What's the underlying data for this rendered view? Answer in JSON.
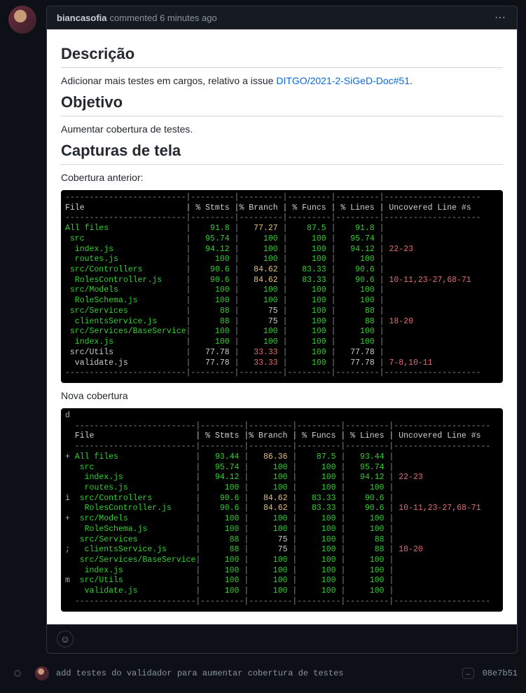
{
  "comment": {
    "author": "biancasofia",
    "action": "commented",
    "time": "6 minutes ago"
  },
  "body": {
    "h1": "Descrição",
    "p1_pre": "Adicionar mais testes em cargos, relativo a issue ",
    "p1_link": "DITGO/2021-2-SiGeD-Doc#51",
    "p1_post": ".",
    "h2": "Objetivo",
    "p2": "Aumentar cobertura de testes.",
    "h3": "Capturas de tela",
    "cov_before_label": "Cobertura anterior:",
    "cov_after_label": "Nova cobertura"
  },
  "coverage_headers": [
    "File",
    "% Stmts",
    "% Branch",
    "% Funcs",
    "% Lines",
    "Uncovered Line #s"
  ],
  "coverage_before": [
    {
      "f": "All files",
      "c": "g",
      "s": "91.8",
      "sc": "g",
      "b": "77.27",
      "bc": "y",
      "fu": "87.5",
      "fc": "g",
      "l": "91.8",
      "lc": "g",
      "u": "",
      "uc": ""
    },
    {
      "f": " src",
      "c": "g",
      "s": "95.74",
      "sc": "g",
      "b": "100",
      "bc": "g",
      "fu": "100",
      "fc": "g",
      "l": "95.74",
      "lc": "g",
      "u": "",
      "uc": ""
    },
    {
      "f": "  index.js",
      "c": "g",
      "s": "94.12",
      "sc": "g",
      "b": "100",
      "bc": "g",
      "fu": "100",
      "fc": "g",
      "l": "94.12",
      "lc": "g",
      "u": "22-23",
      "uc": "r"
    },
    {
      "f": "  routes.js",
      "c": "g",
      "s": "100",
      "sc": "g",
      "b": "100",
      "bc": "g",
      "fu": "100",
      "fc": "g",
      "l": "100",
      "lc": "g",
      "u": "",
      "uc": ""
    },
    {
      "f": " src/Controllers",
      "c": "g",
      "s": "90.6",
      "sc": "g",
      "b": "84.62",
      "bc": "y",
      "fu": "83.33",
      "fc": "g",
      "l": "90.6",
      "lc": "g",
      "u": "",
      "uc": ""
    },
    {
      "f": "  RolesController.js",
      "c": "g",
      "s": "90.6",
      "sc": "g",
      "b": "84.62",
      "bc": "y",
      "fu": "83.33",
      "fc": "g",
      "l": "90.6",
      "lc": "g",
      "u": "10-11,23-27,68-71",
      "uc": "r"
    },
    {
      "f": " src/Models",
      "c": "g",
      "s": "100",
      "sc": "g",
      "b": "100",
      "bc": "g",
      "fu": "100",
      "fc": "g",
      "l": "100",
      "lc": "g",
      "u": "",
      "uc": ""
    },
    {
      "f": "  RoleSchema.js",
      "c": "g",
      "s": "100",
      "sc": "g",
      "b": "100",
      "bc": "g",
      "fu": "100",
      "fc": "g",
      "l": "100",
      "lc": "g",
      "u": "",
      "uc": ""
    },
    {
      "f": " src/Services",
      "c": "g",
      "s": "88",
      "sc": "g",
      "b": "75",
      "bc": "w",
      "fu": "100",
      "fc": "g",
      "l": "88",
      "lc": "g",
      "u": "",
      "uc": ""
    },
    {
      "f": "  clientsService.js",
      "c": "g",
      "s": "88",
      "sc": "g",
      "b": "75",
      "bc": "w",
      "fu": "100",
      "fc": "g",
      "l": "88",
      "lc": "g",
      "u": "18-20",
      "uc": "r"
    },
    {
      "f": " src/Services/BaseService",
      "c": "g",
      "s": "100",
      "sc": "g",
      "b": "100",
      "bc": "g",
      "fu": "100",
      "fc": "g",
      "l": "100",
      "lc": "g",
      "u": "",
      "uc": ""
    },
    {
      "f": "  index.js",
      "c": "g",
      "s": "100",
      "sc": "g",
      "b": "100",
      "bc": "g",
      "fu": "100",
      "fc": "g",
      "l": "100",
      "lc": "g",
      "u": "",
      "uc": ""
    },
    {
      "f": " src/Utils",
      "c": "w",
      "s": "77.78",
      "sc": "w",
      "b": "33.33",
      "bc": "r",
      "fu": "100",
      "fc": "g",
      "l": "77.78",
      "lc": "w",
      "u": "",
      "uc": ""
    },
    {
      "f": "  validate.js",
      "c": "w",
      "s": "77.78",
      "sc": "w",
      "b": "33.33",
      "bc": "r",
      "fu": "100",
      "fc": "g",
      "l": "77.78",
      "lc": "w",
      "u": "7-8,10-11",
      "uc": "r"
    }
  ],
  "coverage_after": [
    {
      "f": "All files",
      "c": "g",
      "s": "93.44",
      "sc": "g",
      "b": "86.36",
      "bc": "y",
      "fu": "87.5",
      "fc": "g",
      "l": "93.44",
      "lc": "g",
      "u": "",
      "uc": "",
      "mk": "+"
    },
    {
      "f": " src",
      "c": "g",
      "s": "95.74",
      "sc": "g",
      "b": "100",
      "bc": "g",
      "fu": "100",
      "fc": "g",
      "l": "95.74",
      "lc": "g",
      "u": "",
      "uc": ""
    },
    {
      "f": "  index.js",
      "c": "g",
      "s": "94.12",
      "sc": "g",
      "b": "100",
      "bc": "g",
      "fu": "100",
      "fc": "g",
      "l": "94.12",
      "lc": "g",
      "u": "22-23",
      "uc": "r"
    },
    {
      "f": "  routes.js",
      "c": "g",
      "s": "100",
      "sc": "g",
      "b": "100",
      "bc": "g",
      "fu": "100",
      "fc": "g",
      "l": "100",
      "lc": "g",
      "u": "",
      "uc": ""
    },
    {
      "f": " src/Controllers",
      "c": "g",
      "s": "90.6",
      "sc": "g",
      "b": "84.62",
      "bc": "y",
      "fu": "83.33",
      "fc": "g",
      "l": "90.6",
      "lc": "g",
      "u": "",
      "uc": "",
      "mk": "i"
    },
    {
      "f": "  RolesController.js",
      "c": "g",
      "s": "90.6",
      "sc": "g",
      "b": "84.62",
      "bc": "y",
      "fu": "83.33",
      "fc": "g",
      "l": "90.6",
      "lc": "g",
      "u": "10-11,23-27,68-71",
      "uc": "r"
    },
    {
      "f": " src/Models",
      "c": "g",
      "s": "100",
      "sc": "g",
      "b": "100",
      "bc": "g",
      "fu": "100",
      "fc": "g",
      "l": "100",
      "lc": "g",
      "u": "",
      "uc": "",
      "mk": "+"
    },
    {
      "f": "  RoleSchema.js",
      "c": "g",
      "s": "100",
      "sc": "g",
      "b": "100",
      "bc": "g",
      "fu": "100",
      "fc": "g",
      "l": "100",
      "lc": "g",
      "u": "",
      "uc": ""
    },
    {
      "f": " src/Services",
      "c": "g",
      "s": "88",
      "sc": "g",
      "b": "75",
      "bc": "w",
      "fu": "100",
      "fc": "g",
      "l": "88",
      "lc": "g",
      "u": "",
      "uc": ""
    },
    {
      "f": "  clientsService.js",
      "c": "g",
      "s": "88",
      "sc": "g",
      "b": "75",
      "bc": "w",
      "fu": "100",
      "fc": "g",
      "l": "88",
      "lc": "g",
      "u": "18-20",
      "uc": "r",
      "mk": ";"
    },
    {
      "f": " src/Services/BaseService",
      "c": "g",
      "s": "100",
      "sc": "g",
      "b": "100",
      "bc": "g",
      "fu": "100",
      "fc": "g",
      "l": "100",
      "lc": "g",
      "u": "",
      "uc": ""
    },
    {
      "f": "  index.js",
      "c": "g",
      "s": "100",
      "sc": "g",
      "b": "100",
      "bc": "g",
      "fu": "100",
      "fc": "g",
      "l": "100",
      "lc": "g",
      "u": "",
      "uc": ""
    },
    {
      "f": " src/Utils",
      "c": "g",
      "s": "100",
      "sc": "g",
      "b": "100",
      "bc": "g",
      "fu": "100",
      "fc": "g",
      "l": "100",
      "lc": "g",
      "u": "",
      "uc": "",
      "mk": "m"
    },
    {
      "f": "  validate.js",
      "c": "g",
      "s": "100",
      "sc": "g",
      "b": "100",
      "bc": "g",
      "fu": "100",
      "fc": "g",
      "l": "100",
      "lc": "g",
      "u": "",
      "uc": ""
    }
  ],
  "colW": {
    "mk": 2,
    "file": 25,
    "num": 9,
    "unc": 20
  },
  "commit": {
    "message": "add testes do validador para aumentar cobertura de testes",
    "sha": "08e7b51"
  }
}
